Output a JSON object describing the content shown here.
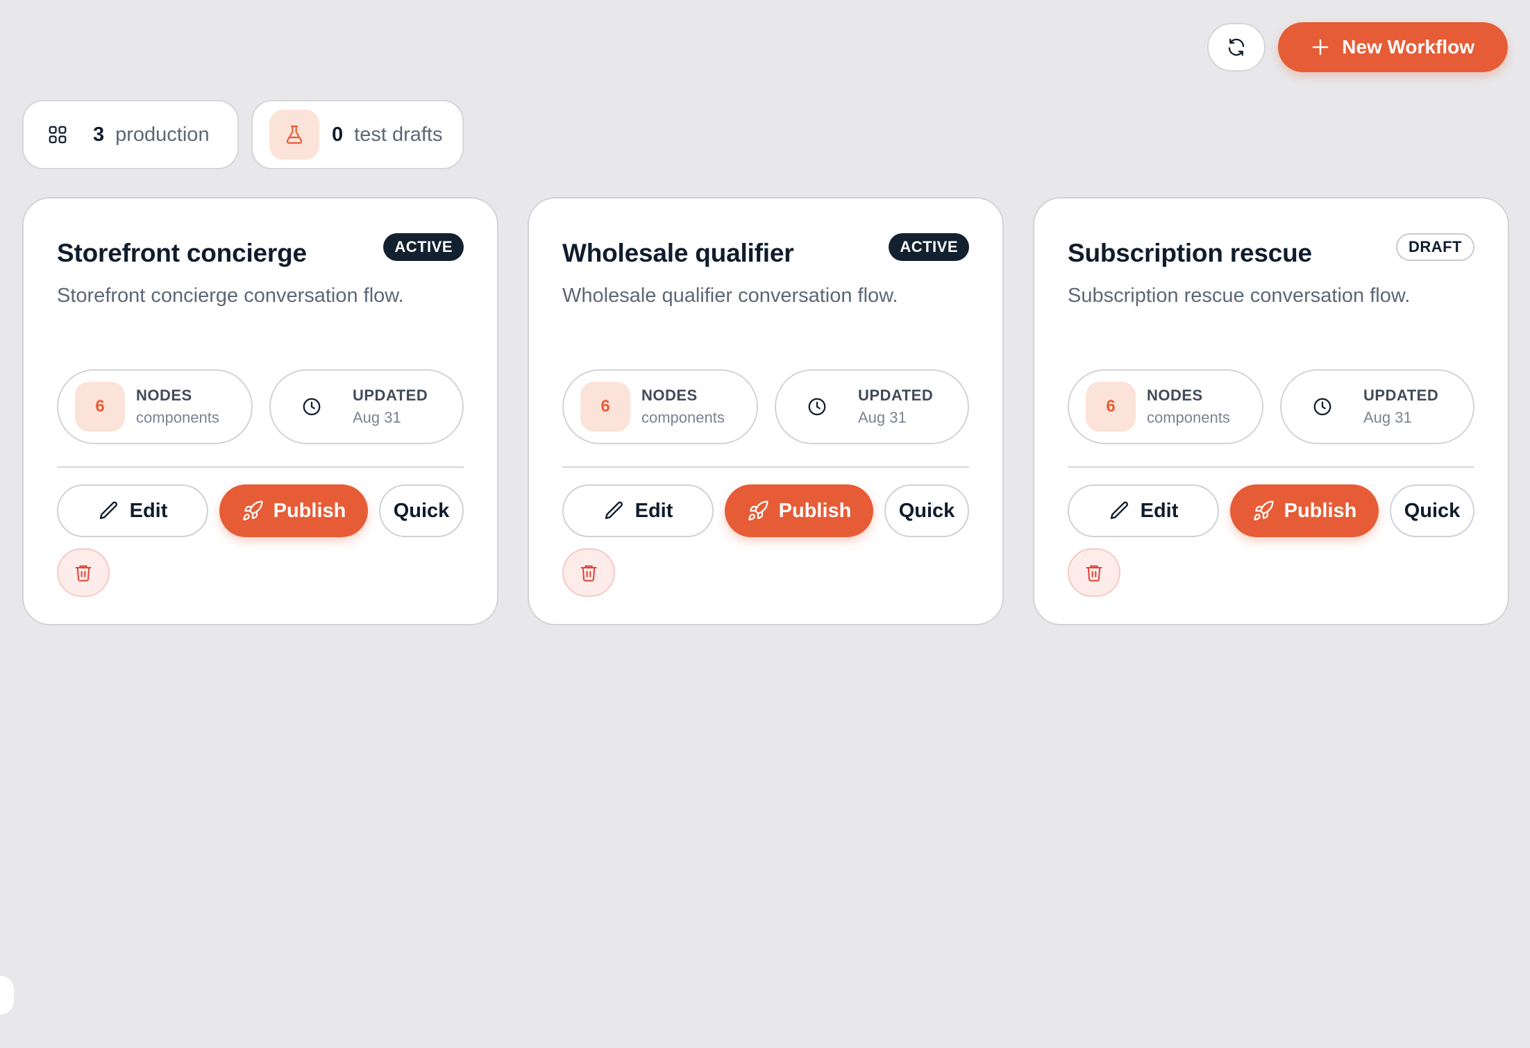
{
  "toolbar": {
    "new_workflow_label": "New Workflow",
    "refresh_icon": "refresh-icon",
    "plus_icon": "plus-icon"
  },
  "stats": {
    "production": {
      "count": "3",
      "label": "production",
      "icon": "grid-icon"
    },
    "test_drafts": {
      "count": "0",
      "label": "test drafts",
      "icon": "flask-icon"
    }
  },
  "colors": {
    "accent": "#e65c36",
    "accent_soft": "#fbe3d9",
    "dark": "#13202f",
    "background": "#e8e8ea",
    "danger_soft": "#fdecea"
  },
  "workflows": [
    {
      "title": "Storefront concierge",
      "status": "ACTIVE",
      "description": "Storefront concierge conversation flow.",
      "nodes_count": "6",
      "nodes_label": "NODES",
      "nodes_sub": "components",
      "updated_label": "UPDATED",
      "updated_value": "Aug 31",
      "edit_label": "Edit",
      "publish_label": "Publish",
      "quick_label": "Quick"
    },
    {
      "title": "Wholesale qualifier",
      "status": "ACTIVE",
      "description": "Wholesale qualifier conversation flow.",
      "nodes_count": "6",
      "nodes_label": "NODES",
      "nodes_sub": "components",
      "updated_label": "UPDATED",
      "updated_value": "Aug 31",
      "edit_label": "Edit",
      "publish_label": "Publish",
      "quick_label": "Quick"
    },
    {
      "title": "Subscription rescue",
      "status": "DRAFT",
      "description": "Subscription rescue conversation flow.",
      "nodes_count": "6",
      "nodes_label": "NODES",
      "nodes_sub": "components",
      "updated_label": "UPDATED",
      "updated_value": "Aug 31",
      "edit_label": "Edit",
      "publish_label": "Publish",
      "quick_label": "Quick"
    }
  ]
}
